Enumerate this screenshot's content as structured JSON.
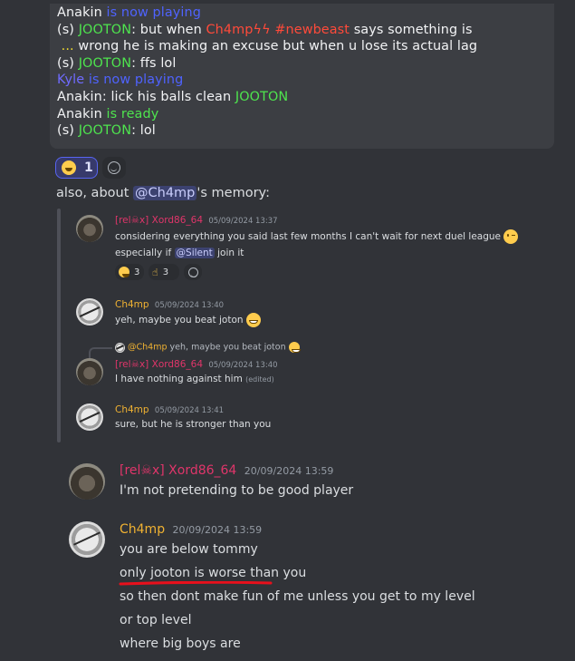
{
  "game_chat": {
    "lines": [
      {
        "parts": [
          {
            "t": "Anakin ",
            "c": "white"
          },
          {
            "t": "is now playing",
            "c": "blue"
          }
        ]
      },
      {
        "parts": [
          {
            "t": "(s) ",
            "c": "white"
          },
          {
            "t": "JOOTON",
            "c": "green"
          },
          {
            "t": ": but when ",
            "c": "white"
          },
          {
            "t": "Ch4mpϟϟ #newbeast",
            "c": "red"
          },
          {
            "t": " says something is",
            "c": "white"
          }
        ]
      },
      {
        "parts": [
          {
            "t": " ... ",
            "c": "yellow"
          },
          {
            "t": "wrong he is making an excuse but when u lose its actual lag",
            "c": "white"
          }
        ]
      },
      {
        "parts": [
          {
            "t": "(s) ",
            "c": "white"
          },
          {
            "t": "JOOTON",
            "c": "green"
          },
          {
            "t": ": ffs lol",
            "c": "white"
          }
        ]
      },
      {
        "parts": [
          {
            "t": "Kyle ",
            "c": "kyle"
          },
          {
            "t": "is now playing",
            "c": "blue"
          }
        ]
      },
      {
        "parts": [
          {
            "t": "Anakin: lick his balls clean ",
            "c": "white"
          },
          {
            "t": "JOOTON",
            "c": "green"
          }
        ]
      },
      {
        "parts": [
          {
            "t": "Anakin ",
            "c": "white"
          },
          {
            "t": "is ready",
            "c": "green"
          }
        ]
      },
      {
        "parts": [
          {
            "t": "(s) ",
            "c": "white"
          },
          {
            "t": "JOOTON",
            "c": "green"
          },
          {
            "t": ": lol",
            "c": "white"
          }
        ]
      }
    ]
  },
  "reactions_top": {
    "laugh_count": "1"
  },
  "also_text": {
    "prefix": "also, about ",
    "mention": "@Ch4mp",
    "suffix": "'s memory:"
  },
  "quoted": {
    "msg1": {
      "author": "[rel☠x] Xord86_64",
      "timestamp": "05/09/2024 13:37",
      "line1": "considering everything you said last few months I can't wait for next duel league",
      "line2_prefix": "especially if ",
      "line2_mention": "@Silent",
      "line2_suffix": " join it",
      "react_laugh": "3",
      "react_point": "3"
    },
    "msg2": {
      "author": "Ch4mp",
      "timestamp": "05/09/2024 13:40",
      "text": "yeh, maybe you beat joton"
    },
    "reply_preview": {
      "author": "@Ch4mp",
      "text": "yeh, maybe you beat joton"
    },
    "msg3": {
      "author": "[rel☠x] Xord86_64",
      "timestamp": "05/09/2024 13:40",
      "text": "I have nothing against him",
      "edited": "(edited)"
    },
    "msg4": {
      "author": "Ch4mp",
      "timestamp": "05/09/2024 13:41",
      "text": "sure, but he is stronger than you"
    }
  },
  "messages": [
    {
      "author": "[rel☠x] Xord86_64",
      "timestamp": "20/09/2024 13:59",
      "lines": [
        "I'm not pretending to be good player"
      ]
    },
    {
      "author": "Ch4mp",
      "timestamp": "20/09/2024 13:59",
      "lines": [
        "you are below tommy",
        "only jooton is worse than you",
        "so then dont make fun of me unless you get to my level",
        "or top level",
        "where big boys are"
      ]
    }
  ],
  "colors": {
    "background": "#313338",
    "relx_name": "#e0356a",
    "ch4mp_name": "#f0b232",
    "annotation_underline": "#e8101c"
  }
}
